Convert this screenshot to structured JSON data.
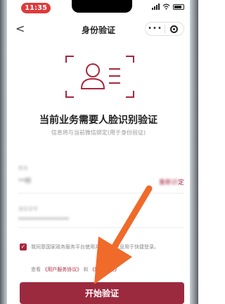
{
  "status_bar": {
    "time": "11:35"
  },
  "nav": {
    "back_glyph": "<",
    "title": "身份验证",
    "more_glyph": "•••"
  },
  "main": {
    "heading": "当前业务需要人脸识别验证",
    "subheading": "信息将与当前微信绑定(用于身份验证)"
  },
  "form": {
    "name_label": "姓名",
    "name_value": "**明",
    "reidentify_blurred": "重新识",
    "reidentify_visible": "定",
    "id_label": "身份证号",
    "id_value": "****************"
  },
  "agreement": {
    "checkbox_glyph": "✓",
    "text": "我同意国家政务服务平台使用并提交的信息用于快捷登录。",
    "view_prefix": "查看",
    "user_agreement": "《用户服务协议》",
    "and_text": "和",
    "privacy_policy": "《隐私政策》"
  },
  "start_button": {
    "label": "开始验证"
  },
  "colors": {
    "brand": "#9c2a3f",
    "time_pill": "#e0393a",
    "annotation_arrow": "#f06a2a"
  },
  "icons": {
    "face_frame": "face-scan-icon",
    "back": "chevron-left-icon",
    "close": "target-close-icon"
  }
}
